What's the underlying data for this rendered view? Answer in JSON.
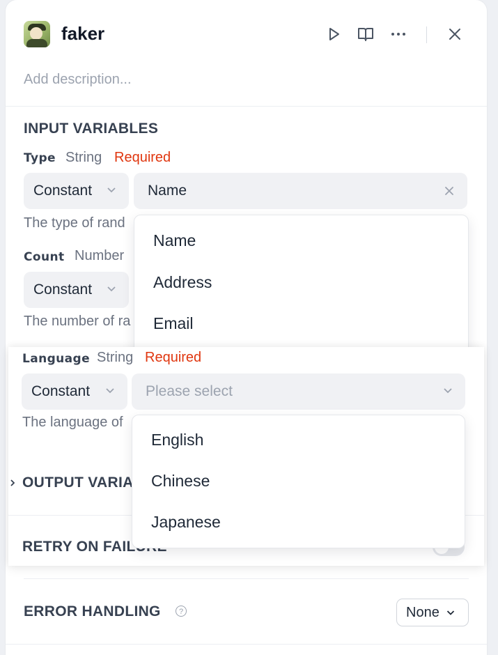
{
  "header": {
    "title": "faker",
    "description_placeholder": "Add description..."
  },
  "input_variables": {
    "section_title": "INPUT VARIABLES",
    "type": {
      "name": "Type",
      "type": "String",
      "required": "Required",
      "mode": "Constant",
      "value": "Name",
      "hint": "The type of rand"
    },
    "type_options": [
      "Name",
      "Address",
      "Email"
    ],
    "count": {
      "name": "Count",
      "type": "Number",
      "mode": "Constant",
      "hint": "The number of ra"
    },
    "language": {
      "name": "Language",
      "type": "String",
      "required": "Required",
      "mode": "Constant",
      "placeholder": "Please select",
      "hint": "The language of"
    },
    "language_options": [
      "English",
      "Chinese",
      "Japanese"
    ]
  },
  "output_variables": {
    "section_title": "OUTPUT VARIA"
  },
  "retry": {
    "section_title": "RETRY ON FAILURE",
    "enabled": false
  },
  "error_handling": {
    "section_title": "ERROR HANDLING",
    "value": "None"
  },
  "colors": {
    "required": "#e0360f",
    "field_bg": "#f0f1f4",
    "muted": "#9ca3af"
  },
  "icons": [
    "run-icon",
    "docs-book-icon",
    "more-icon",
    "close-icon",
    "clear-icon",
    "chevron-down-icon",
    "chevron-right-icon",
    "help-icon"
  ]
}
